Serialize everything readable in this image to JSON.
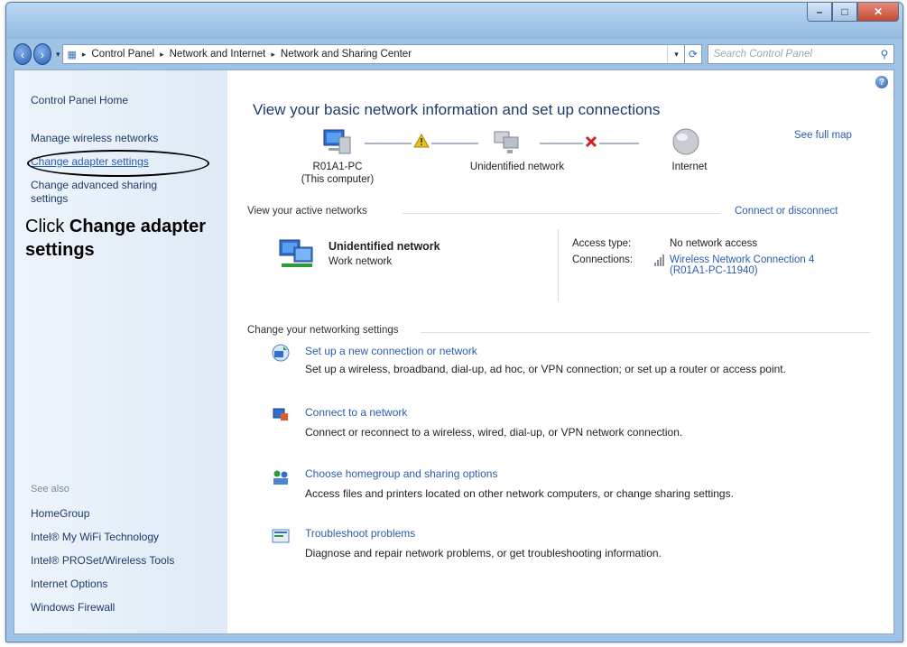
{
  "window": {
    "caption_min": "–",
    "caption_max": "□",
    "caption_close": "✕"
  },
  "address": {
    "crumbs": [
      "Control Panel",
      "Network and Internet",
      "Network and Sharing Center"
    ],
    "search_placeholder": "Search Control Panel"
  },
  "sidebar": {
    "home": "Control Panel Home",
    "items": [
      {
        "label": "Manage wireless networks"
      },
      {
        "label": "Change adapter settings"
      },
      {
        "label": "Change advanced sharing\nsettings"
      }
    ],
    "see_also_title": "See also",
    "see_also": [
      "HomeGroup",
      "Intel® My WiFi Technology",
      "Intel® PROSet/Wireless Tools",
      "Internet Options",
      "Windows Firewall"
    ]
  },
  "callout": {
    "prefix": "Click ",
    "bold": "Change adapter settings"
  },
  "main": {
    "title": "View your basic network information and set up connections",
    "see_full_map": "See full map",
    "map": {
      "computer_name": "R01A1-PC",
      "computer_sub": "(This computer)",
      "network": "Unidentified network",
      "internet": "Internet"
    },
    "active_label": "View your active networks",
    "connect_disconnect": "Connect or disconnect",
    "active_network": {
      "name": "Unidentified network",
      "type": "Work network",
      "access_label": "Access type:",
      "access_value": "No network access",
      "connections_label": "Connections:",
      "connection_link_1": "Wireless Network Connection 4",
      "connection_link_2": "(R01A1-PC-11940)"
    },
    "change_label": "Change your networking settings",
    "tasks": [
      {
        "title": "Set up a new connection or network",
        "desc": "Set up a wireless, broadband, dial-up, ad hoc, or VPN connection; or set up a router or access point."
      },
      {
        "title": "Connect to a network",
        "desc": "Connect or reconnect to a wireless, wired, dial-up, or VPN network connection."
      },
      {
        "title": "Choose homegroup and sharing options",
        "desc": "Access files and printers located on other network computers, or change sharing settings."
      },
      {
        "title": "Troubleshoot problems",
        "desc": "Diagnose and repair network problems, or get troubleshooting information."
      }
    ]
  },
  "colors": {
    "link": "#2a5db0",
    "title": "#1e3a6b",
    "error_x": "#d42020",
    "warning": "#e8c21a"
  }
}
